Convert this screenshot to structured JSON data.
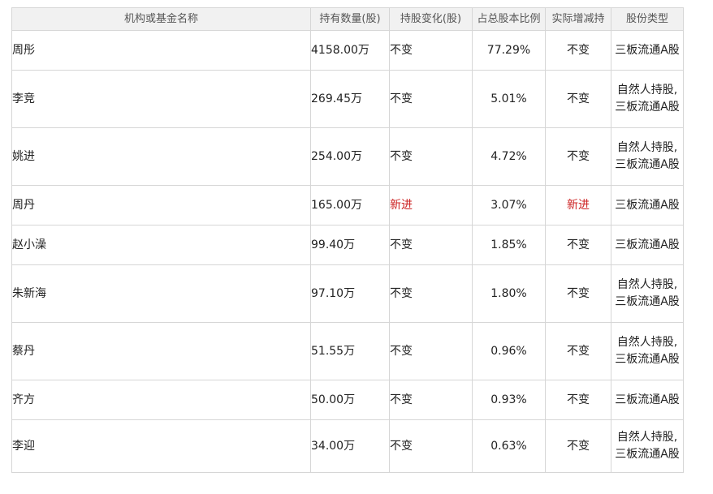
{
  "header": {
    "name": "机构或基金名称",
    "quantity": "持有数量(股)",
    "change": "持股变化(股)",
    "ratio": "占总股本比例",
    "actual": "实际增减持",
    "type": "股份类型"
  },
  "rows": [
    {
      "name": "周彤",
      "quantity": "4158.00万",
      "change": "不变",
      "ratio": "77.29%",
      "actual": "不变",
      "type": "三板流通A股"
    },
    {
      "name": "李竞",
      "quantity": "269.45万",
      "change": "不变",
      "ratio": "5.01%",
      "actual": "不变",
      "type": "自然人持股,三板流通A股"
    },
    {
      "name": "姚进",
      "quantity": "254.00万",
      "change": "不变",
      "ratio": "4.72%",
      "actual": "不变",
      "type": "自然人持股,三板流通A股"
    },
    {
      "name": "周丹",
      "quantity": "165.00万",
      "change": "新进",
      "ratio": "3.07%",
      "actual": "新进",
      "type": "三板流通A股"
    },
    {
      "name": "赵小澡",
      "quantity": "99.40万",
      "change": "不变",
      "ratio": "1.85%",
      "actual": "不变",
      "type": "三板流通A股"
    },
    {
      "name": "朱新海",
      "quantity": "97.10万",
      "change": "不变",
      "ratio": "1.80%",
      "actual": "不变",
      "type": "自然人持股,三板流通A股"
    },
    {
      "name": "蔡丹",
      "quantity": "51.55万",
      "change": "不变",
      "ratio": "0.96%",
      "actual": "不变",
      "type": "自然人持股,三板流通A股"
    },
    {
      "name": "齐方",
      "quantity": "50.00万",
      "change": "不变",
      "ratio": "0.93%",
      "actual": "不变",
      "type": "三板流通A股"
    },
    {
      "name": "李迎",
      "quantity": "34.00万",
      "change": "不变",
      "ratio": "0.63%",
      "actual": "不变",
      "type": "自然人持股,三板流通A股"
    }
  ],
  "colors": {
    "new_highlight": "#cc2222",
    "header_bg": "#f1f1f1",
    "border": "#d6d6d6"
  }
}
